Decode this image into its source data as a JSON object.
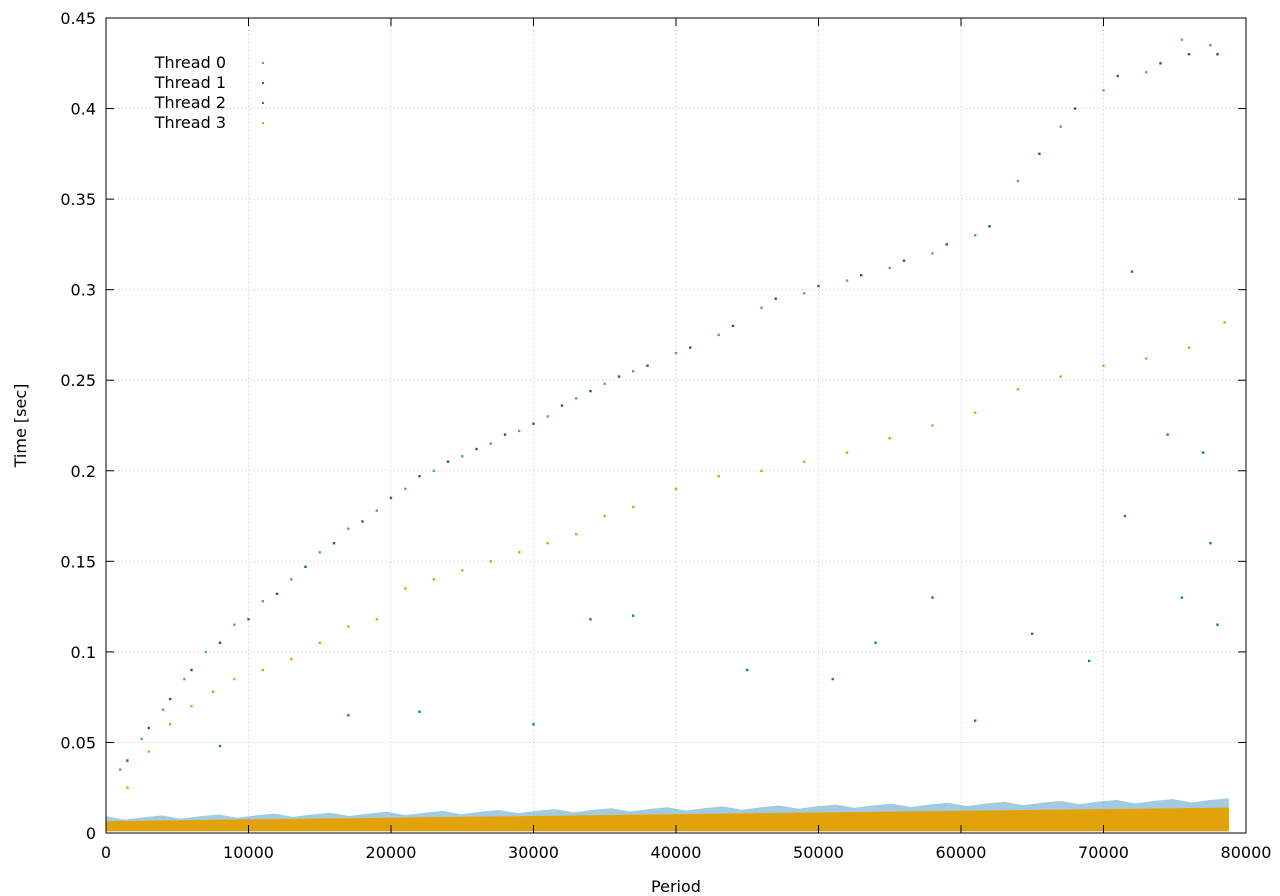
{
  "chart_data": {
    "type": "scatter",
    "title": "",
    "xlabel": "Period",
    "ylabel": "Time [sec]",
    "xlim": [
      0,
      80000
    ],
    "ylim": [
      0,
      0.45
    ],
    "x_ticks": [
      0,
      10000,
      20000,
      30000,
      40000,
      50000,
      60000,
      70000,
      80000
    ],
    "x_tick_labels": [
      "0",
      "10000",
      "20000",
      "30000",
      "40000",
      "50000",
      "60000",
      "70000",
      "80000"
    ],
    "y_ticks": [
      0,
      0.05,
      0.1,
      0.15,
      0.2,
      0.25,
      0.3,
      0.35,
      0.4,
      0.45
    ],
    "y_tick_labels": [
      "0",
      "0.05",
      "0.1",
      "0.15",
      "0.2",
      "0.25",
      "0.3",
      "0.35",
      "0.4",
      "0.45"
    ],
    "grid": true,
    "legend_position": "top-left",
    "series": [
      {
        "name": "Thread 0",
        "color": "#56a0c8",
        "points": [
          [
            1000,
            0.035
          ],
          [
            2500,
            0.052
          ],
          [
            4000,
            0.068
          ],
          [
            5500,
            0.085
          ],
          [
            7000,
            0.1
          ],
          [
            9000,
            0.115
          ],
          [
            11000,
            0.128
          ],
          [
            13000,
            0.14
          ],
          [
            15000,
            0.155
          ],
          [
            17000,
            0.168
          ],
          [
            19000,
            0.178
          ],
          [
            21000,
            0.19
          ],
          [
            23000,
            0.2
          ],
          [
            25000,
            0.208
          ],
          [
            27000,
            0.215
          ],
          [
            29000,
            0.222
          ],
          [
            31000,
            0.23
          ],
          [
            33000,
            0.24
          ],
          [
            35000,
            0.248
          ],
          [
            37000,
            0.255
          ],
          [
            40000,
            0.265
          ],
          [
            43000,
            0.275
          ],
          [
            46000,
            0.29
          ],
          [
            49000,
            0.298
          ],
          [
            52000,
            0.305
          ],
          [
            55000,
            0.312
          ],
          [
            58000,
            0.32
          ],
          [
            61000,
            0.33
          ],
          [
            64000,
            0.36
          ],
          [
            67000,
            0.39
          ],
          [
            70000,
            0.41
          ],
          [
            73000,
            0.42
          ],
          [
            75500,
            0.438
          ],
          [
            77500,
            0.435
          ]
        ]
      },
      {
        "name": "Thread 1",
        "color": "#1b5f8a",
        "points": [
          [
            1500,
            0.04
          ],
          [
            3000,
            0.058
          ],
          [
            4500,
            0.074
          ],
          [
            6000,
            0.09
          ],
          [
            8000,
            0.105
          ],
          [
            10000,
            0.118
          ],
          [
            12000,
            0.132
          ],
          [
            14000,
            0.147
          ],
          [
            16000,
            0.16
          ],
          [
            18000,
            0.172
          ],
          [
            20000,
            0.185
          ],
          [
            22000,
            0.197
          ],
          [
            24000,
            0.205
          ],
          [
            26000,
            0.212
          ],
          [
            28000,
            0.22
          ],
          [
            30000,
            0.226
          ],
          [
            32000,
            0.236
          ],
          [
            34000,
            0.244
          ],
          [
            36000,
            0.252
          ],
          [
            38000,
            0.258
          ],
          [
            41000,
            0.268
          ],
          [
            44000,
            0.28
          ],
          [
            47000,
            0.295
          ],
          [
            50000,
            0.302
          ],
          [
            53000,
            0.308
          ],
          [
            56000,
            0.316
          ],
          [
            59000,
            0.325
          ],
          [
            62000,
            0.335
          ],
          [
            65500,
            0.375
          ],
          [
            68000,
            0.4
          ],
          [
            71000,
            0.418
          ],
          [
            74000,
            0.425
          ],
          [
            76000,
            0.43
          ],
          [
            78000,
            0.43
          ]
        ]
      },
      {
        "name": "Thread 2",
        "color": "#0f7f9a",
        "points": [
          [
            8000,
            0.048
          ],
          [
            17000,
            0.065
          ],
          [
            22000,
            0.067
          ],
          [
            30000,
            0.06
          ],
          [
            34000,
            0.118
          ],
          [
            37000,
            0.12
          ],
          [
            45000,
            0.09
          ],
          [
            51000,
            0.085
          ],
          [
            54000,
            0.105
          ],
          [
            58000,
            0.13
          ],
          [
            61000,
            0.062
          ],
          [
            65000,
            0.11
          ],
          [
            69000,
            0.095
          ],
          [
            71500,
            0.175
          ],
          [
            72000,
            0.31
          ],
          [
            74500,
            0.22
          ],
          [
            75500,
            0.13
          ],
          [
            77000,
            0.21
          ],
          [
            77500,
            0.16
          ],
          [
            78000,
            0.115
          ]
        ]
      },
      {
        "name": "Thread 3",
        "color": "#e69f00",
        "points": [
          [
            1500,
            0.025
          ],
          [
            3000,
            0.045
          ],
          [
            4500,
            0.06
          ],
          [
            6000,
            0.07
          ],
          [
            7500,
            0.078
          ],
          [
            9000,
            0.085
          ],
          [
            11000,
            0.09
          ],
          [
            13000,
            0.096
          ],
          [
            15000,
            0.105
          ],
          [
            17000,
            0.114
          ],
          [
            19000,
            0.118
          ],
          [
            21000,
            0.135
          ],
          [
            23000,
            0.14
          ],
          [
            25000,
            0.145
          ],
          [
            27000,
            0.15
          ],
          [
            29000,
            0.155
          ],
          [
            31000,
            0.16
          ],
          [
            33000,
            0.165
          ],
          [
            35000,
            0.175
          ],
          [
            37000,
            0.18
          ],
          [
            40000,
            0.19
          ],
          [
            43000,
            0.197
          ],
          [
            46000,
            0.2
          ],
          [
            49000,
            0.205
          ],
          [
            52000,
            0.21
          ],
          [
            55000,
            0.218
          ],
          [
            58000,
            0.225
          ],
          [
            61000,
            0.232
          ],
          [
            64000,
            0.245
          ],
          [
            67000,
            0.252
          ],
          [
            70000,
            0.258
          ],
          [
            73000,
            0.262
          ],
          [
            76000,
            0.268
          ],
          [
            78500,
            0.282
          ]
        ]
      }
    ],
    "dense_band": {
      "x_range": [
        0,
        78800
      ],
      "y_floor": 0.001,
      "y_top_start": 0.008,
      "y_top_end": 0.018
    }
  }
}
